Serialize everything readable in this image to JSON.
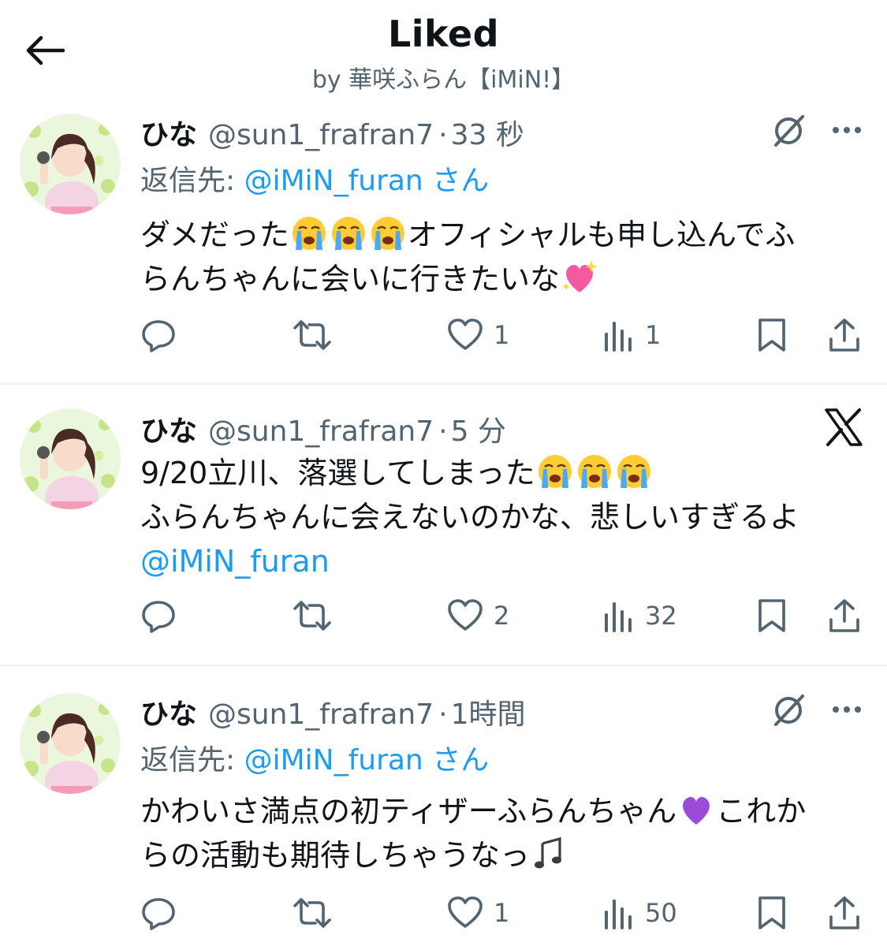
{
  "header": {
    "title": "Liked",
    "subtitle": "by 華咲ふらん【iMiN!】"
  },
  "tweets": [
    {
      "name": "ひな",
      "handle": "@sun1_frafran7",
      "time": "33 秒",
      "reply_prefix": "返信先: ",
      "reply_mention": "@iMiN_furan",
      "reply_suffix": " さん",
      "text_1": "ダメだった",
      "text_2": "オフィシャルも申し込んでふ",
      "text_3": "らんちゃんに会いに行きたいな",
      "counts": {
        "reply": "",
        "retweet": "",
        "like": "1",
        "views": "1"
      },
      "corner_icon": "grok-icon"
    },
    {
      "name": "ひな",
      "handle": "@sun1_frafran7",
      "time": "5 分",
      "text_1": "9/20立川、落選してしまった",
      "text_2": "ふらんちゃんに会えないのかな、悲しいすぎるよ",
      "link": "@iMiN_furan",
      "counts": {
        "reply": "",
        "retweet": "",
        "like": "2",
        "views": "32"
      },
      "corner_icon": "x-logo-icon"
    },
    {
      "name": "ひな",
      "handle": "@sun1_frafran7",
      "time": "1時間",
      "reply_prefix": "返信先: ",
      "reply_mention": "@iMiN_furan",
      "reply_suffix": " さん",
      "text_1": "かわいさ満点の初ティザーふらんちゃん",
      "text_2": "これか",
      "text_3": "らの活動も期待しちゃうなっ",
      "counts": {
        "reply": "",
        "retweet": "",
        "like": "1",
        "views": "50"
      },
      "corner_icon": "grok-icon"
    }
  ],
  "colors": {
    "link": "#1d9bf0",
    "muted": "#536471",
    "text": "#0f1419",
    "divider": "#eff3f4"
  }
}
